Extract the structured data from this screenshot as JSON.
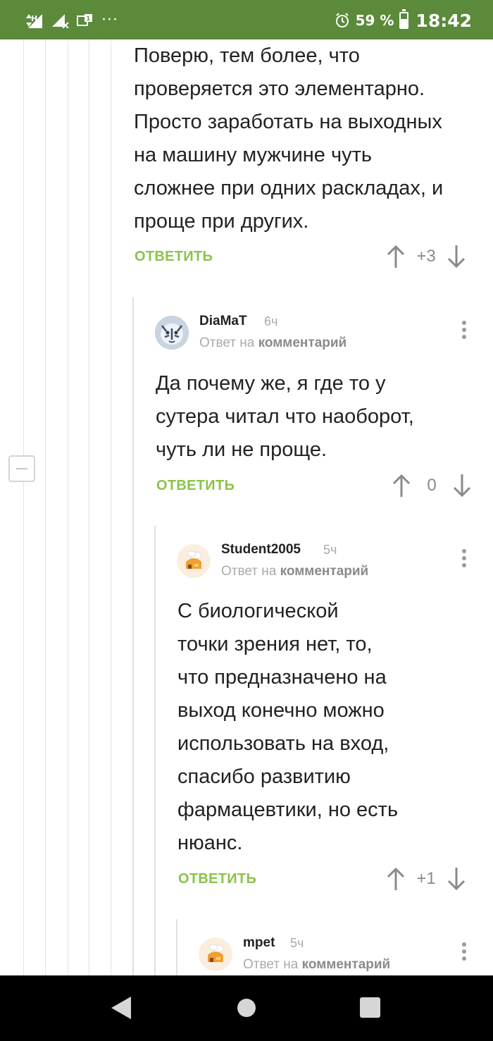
{
  "status_bar": {
    "network": "H",
    "dots": "···",
    "battery_percent": "59 %",
    "battery_level": 0.59,
    "time": "18:42"
  },
  "comments": [
    {
      "text_lines": [
        "Поверю, тем более, что",
        "проверяется это элементарно.",
        "Просто заработать на выходных",
        "на машину мужчине чуть",
        "сложнее при одних раскладах, и",
        "проще при других."
      ],
      "reply_label": "ОТВЕТИТЬ",
      "score": "+3"
    },
    {
      "author": "DiaMaT",
      "time": "6ч",
      "reply_prefix": "Ответ на",
      "reply_link": "комментарий",
      "text_lines": [
        "Да почему же, я где то у",
        "сутера читал что наоборот,",
        "чуть ли не проще."
      ],
      "reply_label": "ОТВЕТИТЬ",
      "score": "0"
    },
    {
      "author": "Student2005",
      "time": "5ч",
      "reply_prefix": "Ответ на",
      "reply_link": "комментарий",
      "text_lines": [
        "С биологической",
        "точки зрения нет, то,",
        "что предназначено на",
        "выход конечно можно",
        "использовать на вход,",
        "спасибо развитию",
        "фармацевтики, но есть",
        "нюанс."
      ],
      "reply_label": "ОТВЕТИТЬ",
      "score": "+1"
    },
    {
      "author": "mpet",
      "time": "5ч",
      "reply_prefix": "Ответ на",
      "reply_link": "комментарий"
    }
  ],
  "colors": {
    "status_bar": "#5a8a3a",
    "reply_green": "#8bc34a",
    "muted": "#8a8a8a",
    "thread_line": "#e3e3e3"
  },
  "icons": [
    "signal-icon",
    "no-signal-icon",
    "sim-icon",
    "alarm-icon",
    "battery-icon",
    "arrow-up-icon",
    "arrow-down-icon",
    "more-vert-icon",
    "collapse-icon",
    "back-icon",
    "home-icon",
    "recents-icon"
  ]
}
